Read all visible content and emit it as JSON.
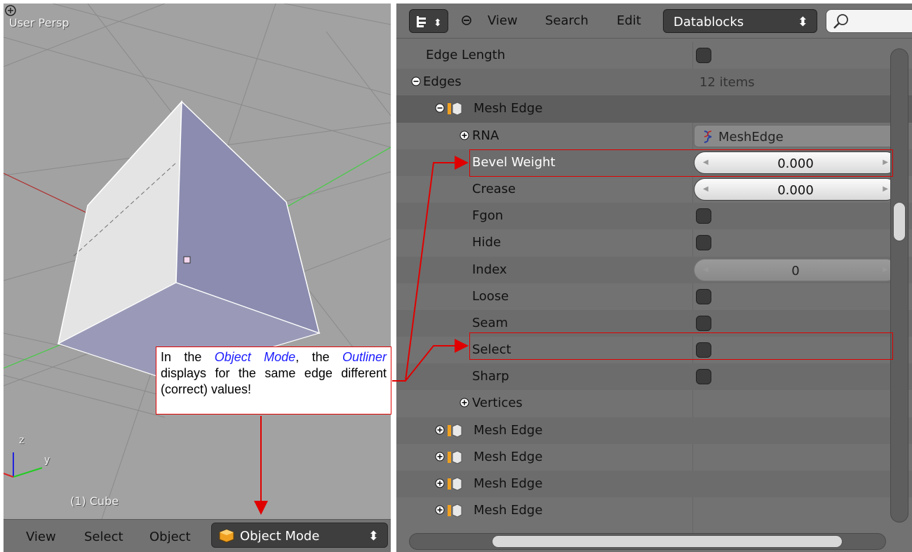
{
  "viewport": {
    "title": "User Persp",
    "object_label": "(1) Cube",
    "axis_z": "z",
    "axis_y": "y",
    "header": {
      "view": "View",
      "select": "Select",
      "object": "Object",
      "mode": "Object Mode"
    }
  },
  "outliner": {
    "menus": {
      "view": "View",
      "search": "Search",
      "edit": "Edit"
    },
    "display_mode": "Datablocks",
    "rows": {
      "edge_length": "Edge Length",
      "edges": "Edges",
      "edges_count": "12 items",
      "mesh_edge": "Mesh Edge",
      "rna": "RNA",
      "rna_value": "MeshEdge",
      "bevel_weight": "Bevel Weight",
      "bevel_weight_value": "0.000",
      "crease": "Crease",
      "crease_value": "0.000",
      "fgon": "Fgon",
      "hide": "Hide",
      "index": "Index",
      "index_value": "0",
      "loose": "Loose",
      "seam": "Seam",
      "select": "Select",
      "sharp": "Sharp",
      "vertices": "Vertices",
      "mesh_edge_2": "Mesh Edge",
      "mesh_edge_3": "Mesh Edge",
      "mesh_edge_4": "Mesh Edge",
      "mesh_edge_5": "Mesh Edge"
    }
  },
  "annotation": {
    "part1": "In the ",
    "em1": "Object Mode",
    "part2": ", the ",
    "em2": "Outliner",
    "part3": " displays for the same edge different (correct) values!"
  },
  "colors": {
    "annotation_red": "#e00000",
    "emphasis_blue": "#1c1cff",
    "cube_face_light": "#e2e2e2",
    "cube_face_blue": "#8c8db0"
  }
}
